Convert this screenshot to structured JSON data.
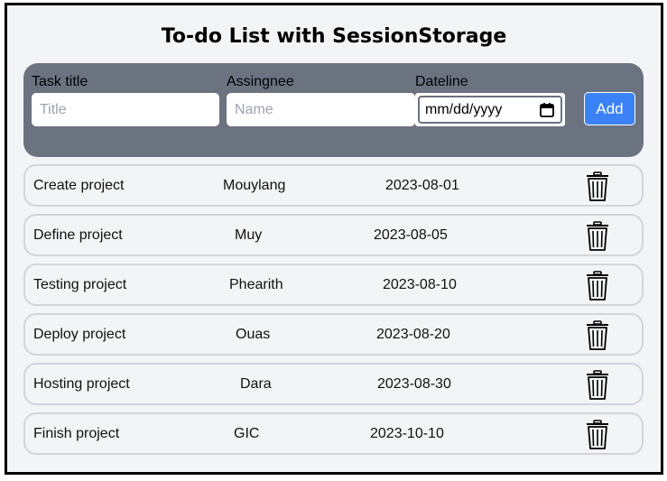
{
  "app": {
    "title": "To-do List with SessionStorage"
  },
  "form": {
    "task_title_label": "Task title",
    "task_title_placeholder": "Title",
    "task_title_value": "",
    "assignee_label": "Assingnee",
    "assignee_placeholder": "Name",
    "assignee_value": "",
    "deadline_label": "Dateline",
    "deadline_placeholder": "mm/dd/yyyy",
    "add_label": "Add"
  },
  "tasks": [
    {
      "title": "Create project",
      "assignee": "Mouylang",
      "date": "2023-08-01",
      "delete_icon": "trash-icon"
    },
    {
      "title": "Define project",
      "assignee": "Muy",
      "date": "2023-08-05",
      "delete_icon": "trash-icon"
    },
    {
      "title": "Testing project",
      "assignee": "Phearith",
      "date": "2023-08-10",
      "delete_icon": "trash-icon"
    },
    {
      "title": "Deploy project",
      "assignee": "Ouas",
      "date": "2023-08-20",
      "delete_icon": "trash-icon"
    },
    {
      "title": "Hosting project",
      "assignee": "Dara",
      "date": "2023-08-30",
      "delete_icon": "trash-icon"
    },
    {
      "title": "Finish project",
      "assignee": "GIC",
      "date": "2023-10-10",
      "delete_icon": "trash-icon"
    }
  ],
  "colors": {
    "form_panel": "#6b7280",
    "add_button": "#3b82f6",
    "page_background": "#f3f4f6",
    "row_border": "#d1d5db"
  }
}
